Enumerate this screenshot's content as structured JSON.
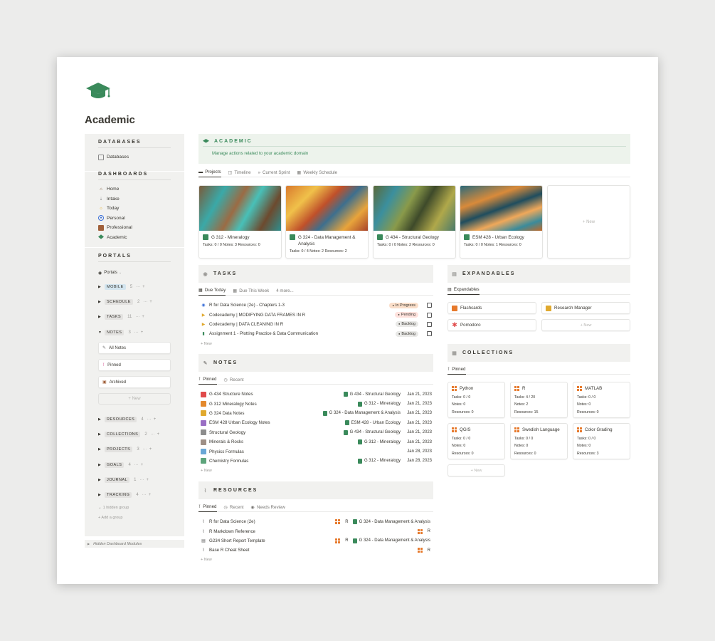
{
  "page": {
    "title": "Academic",
    "icon": "graduation-cap-icon"
  },
  "sidebar": {
    "databases": {
      "heading": "DATABASES",
      "items": [
        {
          "label": "Databases",
          "icon": "database-icon"
        }
      ]
    },
    "dashboards": {
      "heading": "DASHBOARDS",
      "items": [
        {
          "label": "Home",
          "icon": "house-icon"
        },
        {
          "label": "Intake",
          "icon": "arrow-down-icon"
        },
        {
          "label": "Today",
          "icon": "sun-icon"
        },
        {
          "label": "Personal",
          "icon": "person-icon"
        },
        {
          "label": "Professional",
          "icon": "briefcase-icon"
        },
        {
          "label": "Academic",
          "icon": "graduation-cap-icon"
        }
      ]
    },
    "portals": {
      "heading": "PORTALS",
      "view_label": "Portals",
      "groups_top": [
        {
          "label": "MOBILE",
          "count": "5"
        },
        {
          "label": "SCHEDULE",
          "count": "2"
        },
        {
          "label": "TASKS",
          "count": "11"
        },
        {
          "label": "NOTES",
          "count": "3"
        }
      ],
      "notes_cards": [
        "All Notes",
        "Pinned",
        "Archived"
      ],
      "new_label": "+ New",
      "groups_bottom": [
        {
          "label": "RESOURCES",
          "count": "4"
        },
        {
          "label": "COLLECTIONS",
          "count": "2"
        },
        {
          "label": "PROJECTS",
          "count": "3"
        },
        {
          "label": "GOALS",
          "count": "4"
        },
        {
          "label": "JOURNAL",
          "count": "1"
        },
        {
          "label": "TRACKING",
          "count": "4"
        }
      ],
      "hidden_group": "1 hidden group",
      "add_group": "+ Add a group"
    },
    "footer": "Hidden Dashboard Modules"
  },
  "academic": {
    "heading": "ACADEMIC",
    "description": "Manage actions related to your academic domain"
  },
  "project_tabs": [
    "Projects",
    "Timeline",
    "Current Sprint",
    "Weekly Schedule"
  ],
  "projects": [
    {
      "title": "G 312 - Mineralogy",
      "meta": "Tasks: 0 / 0 Notes: 3 Resources: 0"
    },
    {
      "title": "G 324 - Data Management & Analysis",
      "meta": "Tasks: 0 / 4 Notes: 2 Resources: 2"
    },
    {
      "title": "G 434 - Structural Geology",
      "meta": "Tasks: 0 / 0 Notes: 2 Resources: 0"
    },
    {
      "title": "ESM 428 - Urban Ecology",
      "meta": "Tasks: 0 / 0 Notes: 1 Resources: 0"
    }
  ],
  "projects_new": "+ New",
  "tasks": {
    "heading": "TASKS",
    "tabs": [
      "Due Today",
      "Due This Week",
      "4 more..."
    ],
    "rows": [
      {
        "title": "R for Data Science (2e) - Chapters 1-3",
        "status": "In Progress",
        "status_color": "#fadec9"
      },
      {
        "title": "Codecademy | MODIFYING DATA FRAMES IN R",
        "status": "Pending",
        "status_color": "#ffe2dd"
      },
      {
        "title": "Codecademy | DATA CLEANING IN R",
        "status": "Backlog",
        "status_color": "#e9e9e7"
      },
      {
        "title": "Assignment 1 - Plotting Practice & Data Communication",
        "status": "Backlog",
        "status_color": "#e9e9e7"
      }
    ],
    "new_label": "+ New"
  },
  "notes": {
    "heading": "NOTES",
    "tabs": [
      "Pinned",
      "Recent"
    ],
    "rows": [
      {
        "title": "G 434 Structure Notes",
        "project": "G 434 - Structural Geology",
        "date": "Jan 21, 2023",
        "color": "#e04a4a"
      },
      {
        "title": "G 312 Mineralogy Notes",
        "project": "G 312 - Mineralogy",
        "date": "Jan 21, 2023",
        "color": "#e4892c"
      },
      {
        "title": "G 324 Data Notes",
        "project": "G 324 - Data Management & Analysis",
        "date": "Jan 21, 2023",
        "color": "#e0a92e"
      },
      {
        "title": "ESM 428 Urban Ecology Notes",
        "project": "ESM 428 - Urban Ecology",
        "date": "Jan 21, 2023",
        "color": "#9a6fc4"
      },
      {
        "title": "Structural Geology",
        "project": "G 434 - Structural Geology",
        "date": "Jan 21, 2023",
        "color": "#8d8d8d"
      },
      {
        "title": "Minerals & Rocks",
        "project": "G 312 - Mineralogy",
        "date": "Jan 21, 2023",
        "color": "#9e8f86"
      },
      {
        "title": "Physics Formulas",
        "project": "",
        "date": "Jan 28, 2023",
        "color": "#6aa7d6"
      },
      {
        "title": "Chemistry Formulas",
        "project": "G 312 - Mineralogy",
        "date": "Jan 28, 2023",
        "color": "#5da47b"
      }
    ],
    "new_label": "+ New"
  },
  "resources": {
    "heading": "RESOURCES",
    "tabs": [
      "Pinned",
      "Recent",
      "Needs Review"
    ],
    "rows": [
      {
        "title": "R for Data Science (2e)",
        "tag": "R",
        "project": "G 324 - Data Management & Analysis"
      },
      {
        "title": "R Markdown Reference",
        "tag": "R",
        "project": ""
      },
      {
        "title": "G234 Short Report Template",
        "tag": "R",
        "project": "G 324 - Data Management & Analysis"
      },
      {
        "title": "Base R Cheat Sheet",
        "tag": "R",
        "project": ""
      }
    ],
    "new_label": "+ New"
  },
  "expandables": {
    "heading": "EXPANDABLES",
    "tab": "Expandables",
    "items": [
      "Flashcards",
      "Research Manager",
      "Pomodoro"
    ],
    "new_label": "+ New"
  },
  "collections": {
    "heading": "COLLECTIONS",
    "tab": "Pinned",
    "items": [
      {
        "title": "Python",
        "tasks": "Tasks: 0 / 0",
        "notes": "Notes: 0",
        "res": "Resources: 0"
      },
      {
        "title": "R",
        "tasks": "Tasks: 4 / 20",
        "notes": "Notes: 2",
        "res": "Resources: 15"
      },
      {
        "title": "MATLAB",
        "tasks": "Tasks: 0 / 0",
        "notes": "Notes: 0",
        "res": "Resources: 0"
      },
      {
        "title": "QGIS",
        "tasks": "Tasks: 0 / 0",
        "notes": "Notes: 0",
        "res": "Resources: 0"
      },
      {
        "title": "Swedish Language",
        "tasks": "Tasks: 0 / 0",
        "notes": "Notes: 0",
        "res": "Resources: 0"
      },
      {
        "title": "Color Grading",
        "tasks": "Tasks: 0 / 0",
        "notes": "Notes: 0",
        "res": "Resources: 3"
      }
    ],
    "new_label": "+ New"
  },
  "colors": {
    "green": "#3a8a5b",
    "orange": "#e6792b",
    "panel": "#f1f1ef",
    "academic_bg": "#edf3ec"
  }
}
